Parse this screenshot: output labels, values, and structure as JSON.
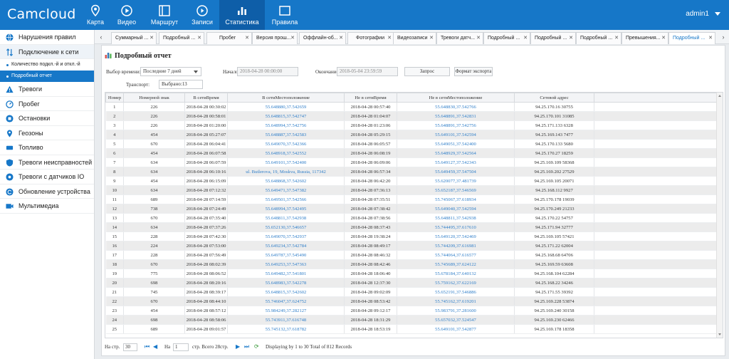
{
  "app": {
    "logo": "Camcloud",
    "user": "admin1"
  },
  "nav": [
    {
      "label": "Карта",
      "icon": "map-pin-icon",
      "active": false
    },
    {
      "label": "Видео",
      "icon": "video-play-icon",
      "active": false
    },
    {
      "label": "Маршрут",
      "icon": "route-icon",
      "active": false
    },
    {
      "label": "Записи",
      "icon": "record-play-icon",
      "active": false
    },
    {
      "label": "Статистика",
      "icon": "bar-chart-icon",
      "active": true
    },
    {
      "label": "Правила",
      "icon": "rules-window-icon",
      "active": false
    }
  ],
  "sidebar": {
    "items": [
      {
        "label": "Нарушения правил",
        "icon": "globe-icon"
      },
      {
        "label": "Подключение к сети",
        "icon": "sort-arrows-icon",
        "open": true,
        "children": [
          {
            "label": "Количество подкл.-й и откл.-й",
            "active": false
          },
          {
            "label": "Подробный отчет",
            "active": true
          }
        ]
      },
      {
        "label": "Тревоги",
        "icon": "warning-icon"
      },
      {
        "label": "Пробег",
        "icon": "gauge-icon"
      },
      {
        "label": "Остановки",
        "icon": "stop-icon"
      },
      {
        "label": "Геозоны",
        "icon": "location-icon"
      },
      {
        "label": "Топливо",
        "icon": "fuel-icon"
      },
      {
        "label": "Тревоги неисправностей",
        "icon": "shield-icon"
      },
      {
        "label": "Тревоги с датчиков IO",
        "icon": "sensor-icon"
      },
      {
        "label": "Обновление устройства",
        "icon": "refresh-icon"
      },
      {
        "label": "Мультимедиа",
        "icon": "media-icon"
      }
    ]
  },
  "tabs": [
    {
      "label": "Суммарный ..."
    },
    {
      "label": "Подробный ..."
    },
    {
      "label": "Пробег"
    },
    {
      "label": "Версия прош..."
    },
    {
      "label": "Оффлайн-об..."
    },
    {
      "label": "Фотографии"
    },
    {
      "label": "Видеозаписи"
    },
    {
      "label": "Тревоги датч..."
    },
    {
      "label": "Подробный ..."
    },
    {
      "label": "Подробный ..."
    },
    {
      "label": "Подробный ..."
    },
    {
      "label": "Превышения..."
    },
    {
      "label": "Подробный ...",
      "active": true
    }
  ],
  "panel": {
    "title": "Подробный отчет",
    "time_label": "Выбор времени:",
    "time_value": "Последние 7 дней",
    "start_label": "Начало:",
    "start_value": "2018-04-28 00:00:00",
    "end_label": "Окончание:",
    "end_value": "2018-05-04 23:59:59",
    "query_label": "Запрос",
    "export_label": "Формат экспорта",
    "transport_label": "Транспорт:",
    "transport_value": "Выбрано:13"
  },
  "table": {
    "columns": [
      "Номер",
      "Номерной знак",
      "В сетиВремя",
      "В сетиМестоположение",
      "Не в сетиВремя",
      "Не в сетиМестоположение",
      "Сетевой адрес"
    ],
    "rows": [
      [
        "1",
        "226",
        "2018-04-28 00:30:02",
        "55.648880,37.542659",
        "2018-04-28 00:57:40",
        "55.648830,37.542766",
        "94.25.170.16 30755"
      ],
      [
        "2",
        "226",
        "2018-04-28 00:58:01",
        "55.648815,37.542747",
        "2018-04-28 01:04:07",
        "55.648891,37.542831",
        "94.25.170.101 31085"
      ],
      [
        "3",
        "226",
        "2018-04-28 01:20:00",
        "55.648994,37.542756",
        "2018-04-28 01:23:06",
        "55.648891,37.542756",
        "94.25.171.133 6328"
      ],
      [
        "4",
        "454",
        "2018-04-28 05:27:07",
        "55.648887,37.542583",
        "2018-04-28 05:29:15",
        "55.649101,37.542594",
        "94.25.169.143 7477"
      ],
      [
        "5",
        "670",
        "2018-04-28 06:04:41",
        "55.649070,37.542366",
        "2018-04-28 06:05:57",
        "55.649051,37.542400",
        "94.25.170.133 5680"
      ],
      [
        "6",
        "454",
        "2018-04-28 06:07:58",
        "55.648918,37.542552",
        "2018-04-28 06:08:19",
        "55.648929,37.542564",
        "94.25.170.27 18259"
      ],
      [
        "7",
        "634",
        "2018-04-28 06:07:59",
        "55.649101,37.542400",
        "2018-04-28 06:09:06",
        "55.649127,37.542343",
        "94.25.169.109 58368"
      ],
      [
        "8",
        "634",
        "2018-04-28 06:10:16",
        "ul. Butlerova, 19, Moskva, Russia, 117342",
        "2018-04-28 06:57:34",
        "55.649459,37.547504",
        "94.25.169.202 27529"
      ],
      [
        "9",
        "454",
        "2018-04-28 06:15:09",
        "55.648868,37.542602",
        "2018-04-28 06:42:20",
        "55.620077,37.481739",
        "94.25.169.105 20071"
      ],
      [
        "10",
        "634",
        "2018-04-28 07:12:32",
        "55.649471,37.547382",
        "2018-04-28 07:36:13",
        "55.652187,37.546569",
        "94.25.168.112 9927"
      ],
      [
        "11",
        "689",
        "2018-04-28 07:14:59",
        "55.649501,37.542566",
        "2018-04-28 07:35:51",
        "55.745067,37.618934",
        "94.25.170.178 19039"
      ],
      [
        "12",
        "738",
        "2018-04-28 07:24:49",
        "55.648994,37.542495",
        "2018-04-28 07:38:42",
        "55.649040,37.542594",
        "94.25.170.249 21233"
      ],
      [
        "13",
        "670",
        "2018-04-28 07:35:40",
        "55.648811,37.542938",
        "2018-04-28 07:38:56",
        "55.648811,37.542938",
        "94.25.170.22 54757"
      ],
      [
        "14",
        "634",
        "2018-04-28 07:37:26",
        "55.652130,37.546657",
        "2018-04-28 08:37:43",
        "55.744495,37.617610",
        "94.25.171.94 32777"
      ],
      [
        "15",
        "228",
        "2018-04-28 07:42:30",
        "55.649070,37.542937",
        "2018-04-28 19:38:24",
        "55.649120,37.542469",
        "94.25.169.105 57421"
      ],
      [
        "16",
        "224",
        "2018-04-28 07:53:00",
        "55.649234,37.542784",
        "2018-04-28 08:49:17",
        "55.744209,37.616981",
        "94.25.171.22 62004"
      ],
      [
        "17",
        "228",
        "2018-04-28 07:56:49",
        "55.649787,37.545490",
        "2018-04-28 08:46:32",
        "55.744064,37.616577",
        "94.25.168.68 64706"
      ],
      [
        "18",
        "670",
        "2018-04-28 08:02:39",
        "55.649253,37.547363",
        "2018-04-28 08:42:46",
        "55.745689,37.624122",
        "94.25.169.59 63608"
      ],
      [
        "19",
        "775",
        "2018-04-28 08:06:52",
        "55.649482,37.541801",
        "2018-04-28 18:06:40",
        "55.678184,37.640132",
        "94.25.168.104 62284"
      ],
      [
        "20",
        "698",
        "2018-04-28 08:20:16",
        "55.648983,37.542278",
        "2018-04-28 12:37:30",
        "55.759162,37.622169",
        "94.25.168.22 34246"
      ],
      [
        "21",
        "745",
        "2018-04-28 08:39:17",
        "55.648815,37.542602",
        "2018-04-28 09:02:09",
        "55.652191,37.546886",
        "94.25.171.55 39392"
      ],
      [
        "22",
        "670",
        "2018-04-28 08:44:10",
        "55.746047,37.624752",
        "2018-04-28 08:53:42",
        "55.745162,37.619201",
        "94.25.169.228 53874"
      ],
      [
        "23",
        "454",
        "2018-04-28 08:57:12",
        "55.984249,37.282127",
        "2018-04-28 09:12:17",
        "55.983791,37.281600",
        "94.25.169.240 30158"
      ],
      [
        "24",
        "698",
        "2018-04-28 08:58:06",
        "55.743911,37.616748",
        "2018-04-28 18:31:29",
        "55.657032,37.524547",
        "94.25.169.230 62466"
      ],
      [
        "25",
        "689",
        "2018-04-28 09:01:57",
        "55.745132,37.618782",
        "2018-04-28 18:53:19",
        "55.649101,37.542877",
        "94.25.169.178 18358"
      ]
    ]
  },
  "pager": {
    "per_page_label": "На стр.",
    "per_page_value": "30",
    "page_label": "На",
    "page_value": "1",
    "total_pages_label": "стр. Всего 28стр.",
    "summary": "Displaying by 1 to 30 Total of 812 Records"
  }
}
